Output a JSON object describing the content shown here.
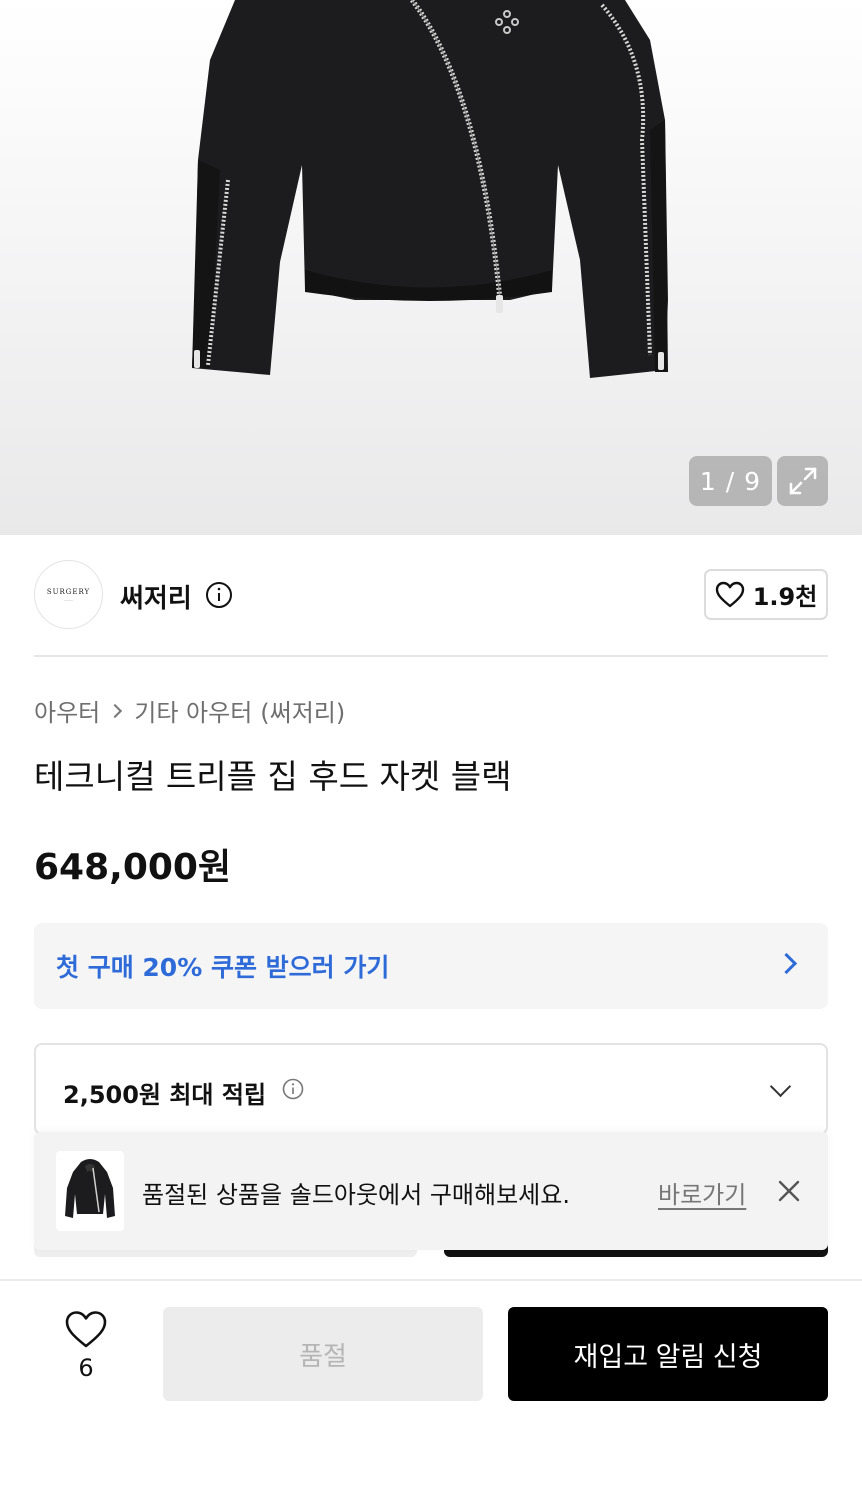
{
  "gallery": {
    "counter_text": "1 / 9",
    "expand_icon": "expand-icon"
  },
  "brand": {
    "logo_text": "SURGERY",
    "name": "써저리",
    "info_icon": "info-icon",
    "like_count": "1.9천",
    "like_icon": "heart-outline-icon"
  },
  "breadcrumb": {
    "category": "아우터",
    "separator_icon": "chevron-right-icon",
    "subcategory": "기타 아우터",
    "brand_tag": "(써저리)"
  },
  "product": {
    "title": "테크니컬 트리플 집 후드 자켓 블랙",
    "price": "648,000원"
  },
  "coupon": {
    "text": "첫 구매 20% 쿠폰 받으러 가기",
    "arrow_icon": "chevron-right-icon"
  },
  "points": {
    "text": "2,500원 최대 적립",
    "info_icon": "info-icon",
    "caret_icon": "chevron-down-icon"
  },
  "toast": {
    "message": "품절된 상품을 솔드아웃에서 구매해보세요.",
    "link": "바로가기",
    "close_icon": "close-icon"
  },
  "bottom_bar": {
    "wish_count": "6",
    "wish_icon": "heart-outline-icon",
    "soldout_label": "품절",
    "restock_label": "재입고 알림 신청"
  },
  "colors": {
    "accent_blue": "#2e6bd8",
    "primary_black": "#000000",
    "disabled_gray": "#ececec"
  }
}
